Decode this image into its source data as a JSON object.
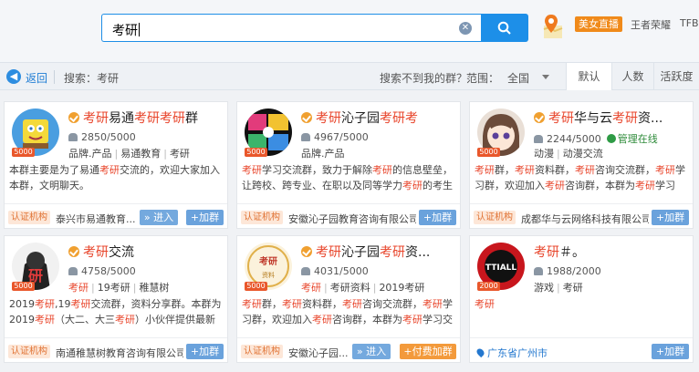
{
  "search": {
    "value": "考研",
    "clear_icon": "clear-circle-icon",
    "button_icon": "search-icon"
  },
  "header": {
    "live_badge": "美女直播",
    "links": [
      "王者荣耀",
      "TFBOYS"
    ]
  },
  "filterbar": {
    "back_label": "返回",
    "search_term": "搜索：考研",
    "not_found": "搜索不到我的群？",
    "range_label": "范围：",
    "range_value": "全国",
    "sort_tabs": [
      "默认",
      "人数",
      "活跃度"
    ],
    "active_tab": "默认"
  },
  "cards": [
    {
      "title_parts": [
        "考研",
        "易通",
        "考研考研",
        "群"
      ],
      "members": "2850/5000",
      "tags": [
        "品牌.产品",
        "易通教育",
        "考研"
      ],
      "capacity": "5000",
      "desc": "本群主要是为了易通考研交流的，欢迎大家加入本群，文明聊天。",
      "cert": "认证机构",
      "org": "泰兴市易通教育...",
      "enter": "» 进入",
      "join": "+加群"
    },
    {
      "title_parts": [
        "考研",
        "沁子园",
        "考研考",
        ""
      ],
      "members": "4967/5000",
      "tags": [
        "品牌.产品"
      ],
      "capacity": "5000",
      "desc": "考研学习交流群，致力于解除考研的信息壁垒，让跨校、跨专业、在职以及同等学力考研的考生与...",
      "cert": "认证机构",
      "org": "安徽沁子园教育咨询有限公司",
      "join": "+加群"
    },
    {
      "title_parts": [
        "考研",
        "华与云",
        "考研",
        "资..."
      ],
      "members": "2244/5000",
      "admin": "管理在线",
      "tags": [
        "动漫",
        "动漫交流"
      ],
      "capacity": "5000",
      "desc": "考研群，考研资料群，考研咨询交流群，考研学习群，欢迎加入考研咨询群，本群为考研学习交...",
      "cert": "认证机构",
      "org": "成都华与云网络科技有限公司",
      "join": "+加群"
    },
    {
      "title_parts": [
        "考研",
        "交流",
        "",
        ""
      ],
      "members": "4758/5000",
      "tags": [
        "考研",
        "19考研",
        "稚慧树"
      ],
      "capacity": "5000",
      "desc": "2019考研,19考研交流群，资料分享群。本群为2019考研（大二、大三考研）小伙伴提供最新考研...",
      "cert": "认证机构",
      "org": "南通稚慧树教育咨询有限公司",
      "join": "+加群"
    },
    {
      "title_parts": [
        "考研",
        "沁子园",
        "考研",
        "资..."
      ],
      "members": "4031/5000",
      "tags": [
        "考研",
        "考研资料",
        "2019考研"
      ],
      "capacity": "5000",
      "desc": "考研群，考研资料群，考研咨询交流群，考研学习群，欢迎加入考研咨询群，本群为考研学习交流...",
      "cert": "认证机构",
      "org": "安徽沁子园...",
      "enter": "» 进入",
      "pay_join": "+付费加群"
    },
    {
      "title_parts": [
        "考研",
        "＃。",
        "",
        ""
      ],
      "members": "1988/2000",
      "tags": [
        "游戏",
        "考研"
      ],
      "capacity": "2000",
      "desc": "考研",
      "location": "广东省广州市",
      "join": "+加群"
    }
  ],
  "colors": {
    "accent": "#1d8fe8",
    "highlight": "#e8452b",
    "badge": "#e9572b",
    "cert_bg": "#fde7d8"
  }
}
